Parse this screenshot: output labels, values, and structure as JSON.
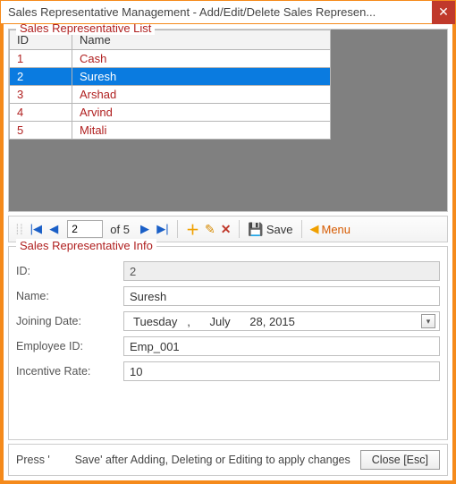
{
  "window": {
    "title": "Sales Representative Management - Add/Edit/Delete Sales Represen..."
  },
  "list": {
    "group_title": "Sales Representative List",
    "columns": {
      "id": "ID",
      "name": "Name"
    },
    "rows": [
      {
        "id": "1",
        "name": "Cash",
        "selected": false
      },
      {
        "id": "2",
        "name": "Suresh",
        "selected": true
      },
      {
        "id": "3",
        "name": "Arshad",
        "selected": false
      },
      {
        "id": "4",
        "name": "Arvind",
        "selected": false
      },
      {
        "id": "5",
        "name": "Mitali",
        "selected": false
      }
    ]
  },
  "nav": {
    "current": "2",
    "of_text": "of 5",
    "save_label": "Save",
    "menu_label": "Menu"
  },
  "info": {
    "group_title": "Sales Representative Info",
    "labels": {
      "id": "ID:",
      "name": "Name:",
      "joining": "Joining Date:",
      "emp": "Employee ID:",
      "incentive": "Incentive Rate:"
    },
    "values": {
      "id": "2",
      "name": "Suresh",
      "joining": "Tuesday   ,      July      28, 2015",
      "emp": "Emp_001",
      "incentive": "10"
    }
  },
  "footer": {
    "hint": "Press '        Save' after Adding, Deleting or Editing to apply changes",
    "close_label": "Close [Esc]"
  }
}
